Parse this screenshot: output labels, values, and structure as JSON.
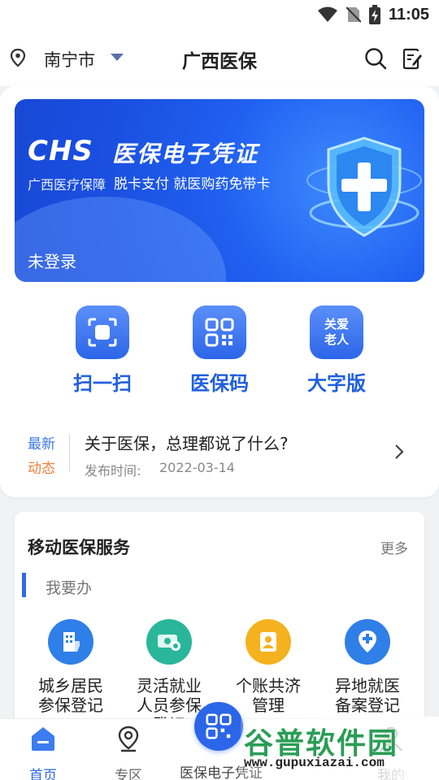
{
  "status_bar": {
    "time": "11:05"
  },
  "top_nav": {
    "city": "南宁市",
    "title": "广西医保"
  },
  "banner": {
    "logo_text": "CHS",
    "title": "医保电子凭证",
    "subtitle_left": "广西医疗保障",
    "subtitle_right": "脱卡支付 就医购药免带卡",
    "login_status": "未登录"
  },
  "quick_actions": [
    {
      "label": "扫一扫",
      "icon": "scan-icon"
    },
    {
      "label": "医保码",
      "icon": "qrcode-icon"
    },
    {
      "label": "大字版",
      "icon": "elderly-care-icon",
      "icon_text": "关爱老人"
    }
  ],
  "news": {
    "tag_line1": "最新",
    "tag_line2": "动态",
    "title": "关于医保，总理都说了什么?",
    "date_label": "发布时间:",
    "date": "2022-03-14"
  },
  "services": {
    "title": "移动医保服务",
    "more": "更多",
    "section": "我要办",
    "items": [
      {
        "label": "城乡居民参保登记",
        "icon": "building-icon",
        "color": "#2f7fe8"
      },
      {
        "label": "灵活就业人员参保登记",
        "icon": "money-icon",
        "color": "#2ab69a"
      },
      {
        "label": "个账共济管理",
        "icon": "account-icon",
        "color": "#f5b21f"
      },
      {
        "label": "异地就医备案登记",
        "icon": "location-plus-icon",
        "color": "#2f7fe8"
      }
    ]
  },
  "bottom_nav": {
    "home": "首页",
    "zone": "专区",
    "center": "医保电子凭证",
    "mine": "我的"
  },
  "watermark": {
    "main": "谷普软件园",
    "url": "www.gupuxiazai.com"
  },
  "colors": {
    "primary": "#2c66e8",
    "accent_orange": "#f0803c"
  }
}
